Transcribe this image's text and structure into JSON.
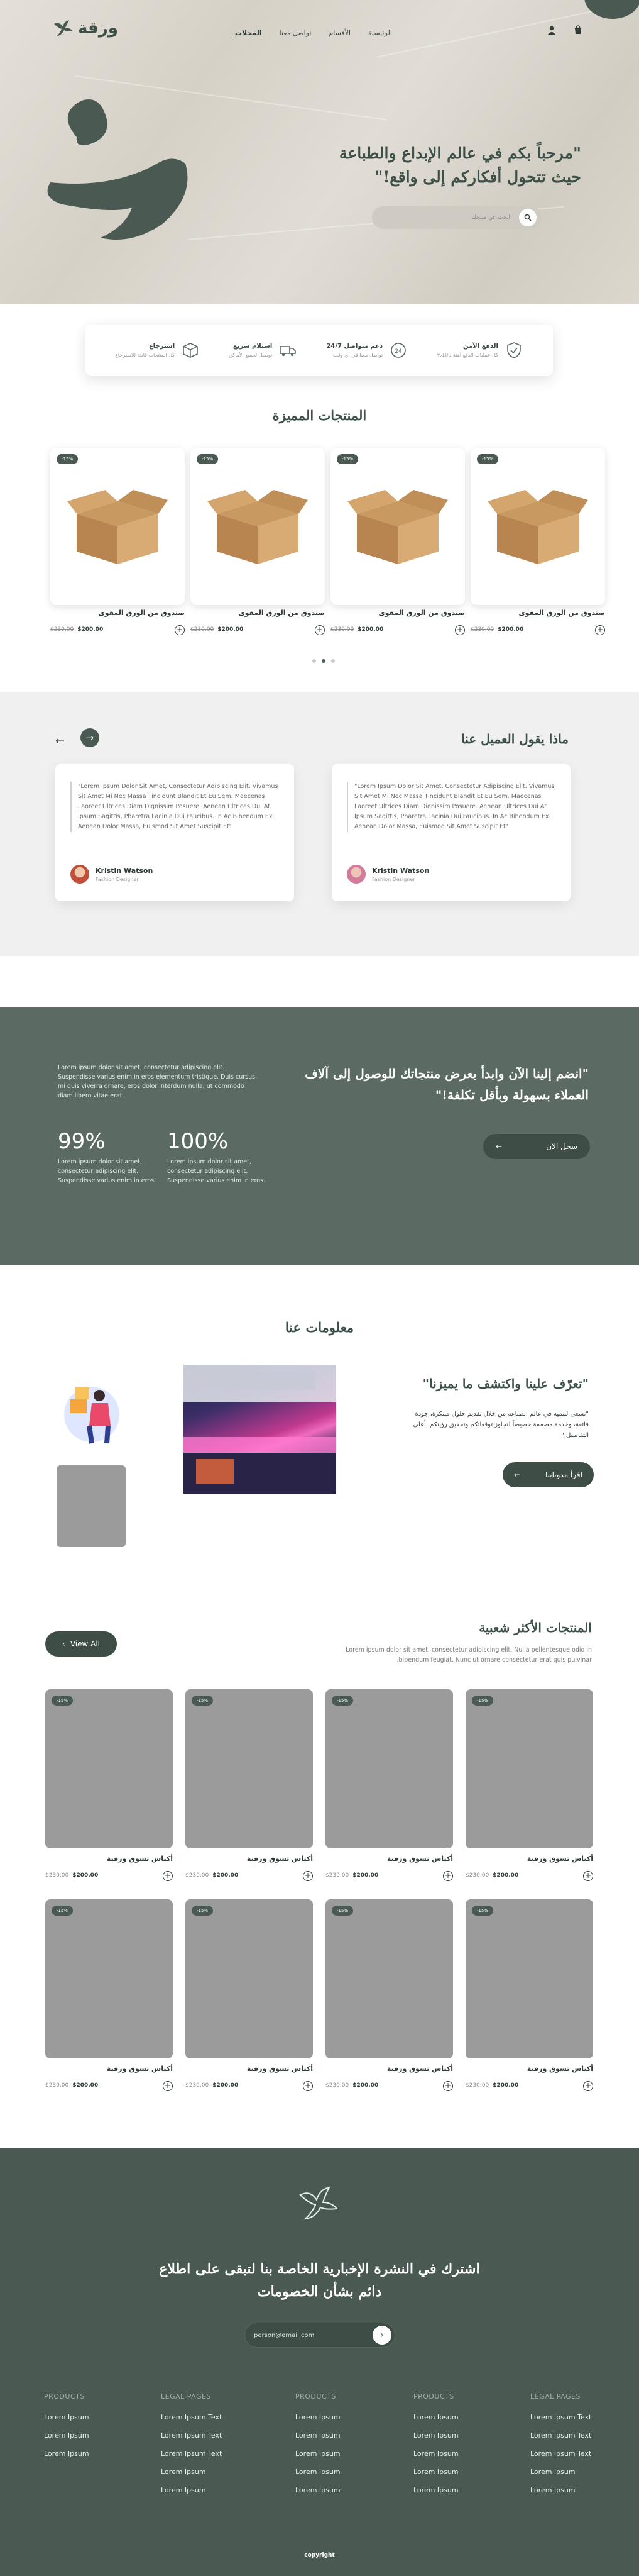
{
  "brand": {
    "name": "ورقة",
    "accent": "#4a5a53",
    "accent_dark": "#3f4d47"
  },
  "nav": {
    "items": [
      "الرئيسية",
      "الأقسام",
      "تواصل معنا",
      "المجلات"
    ],
    "active_index": 3
  },
  "hero": {
    "title_line1": "\"مرحباً بكم في عالم الإبداع والطباعة",
    "title_line2": "حيث تتحول أفكاركم إلى واقع!\"",
    "search_placeholder": "ابحث عن منتجك"
  },
  "features": [
    {
      "title": "الدفع الآمن",
      "subtitle": "كل عمليات الدفع آمنة 100%",
      "icon": "shield-check-icon"
    },
    {
      "title": "دعم متواصل 24/7",
      "subtitle": "تواصل معنا في أي وقت",
      "icon": "support-24-icon"
    },
    {
      "title": "استلام سريع",
      "subtitle": "توصيل لجميع الأماكن",
      "icon": "delivery-truck-icon"
    },
    {
      "title": "استرجاع",
      "subtitle": "كل المنتجات قابلة للاسترجاع",
      "icon": "package-return-icon"
    }
  ],
  "featured": {
    "title": "المنتجات المميزة",
    "products": [
      {
        "badge": "-15%",
        "name": "صندوق من الورق المقوى",
        "old_price": "$230.00",
        "price": "$200.00"
      },
      {
        "badge": "-15%",
        "name": "صندوق من الورق المقوى",
        "old_price": "$230.00",
        "price": "$200.00"
      },
      {
        "badge": "-15%",
        "name": "صندوق من الورق المقوى",
        "old_price": "$230.00",
        "price": "$200.00"
      },
      {
        "badge": "-15%",
        "name": "صندوق من الورق المقوى",
        "old_price": "$230.00",
        "price": "$200.00"
      }
    ],
    "carousel_active": 1
  },
  "testimonials": {
    "title": "ماذا يقول العميل عنا",
    "items": [
      {
        "quote": "\"Lorem Ipsum Dolor Sit Amet, Consectetur Adipiscing Elit. Vivamus Sit Amet Mi Nec Massa Tincidunt Blandit Et Eu Sem. Maecenas Laoreet Ultrices Diam Dignissim Posuere. Aenean Ultrices Dui At Ipsum Sagittis, Pharetra Lacinia Dui Faucibus. In Ac Bibendum Ex. Aenean Dolor Massa, Euismod Sit Amet Suscipit Et\"",
        "name": "Kristin Watson",
        "role": "Fashion Designer"
      },
      {
        "quote": "\"Lorem Ipsum Dolor Sit Amet, Consectetur Adipiscing Elit. Vivamus Sit Amet Mi Nec Massa Tincidunt Blandit Et Eu Sem. Maecenas Laoreet Ultrices Diam Dignissim Posuere. Aenean Ultrices Dui At Ipsum Sagittis, Pharetra Lacinia Dui Faucibus. In Ac Bibendum Ex. Aenean Dolor Massa, Euismod Sit Amet Suscipit Et\"",
        "name": "Kristin Watson",
        "role": "Fashion Designer"
      }
    ]
  },
  "join": {
    "title_line1": "\"انضم إلينا الآن وابدأ بعرض منتجاتك للوصول إلى آلاف",
    "title_line2": "العملاء بسهولة وبأقل تكلفة!\"",
    "button": "سجل الآن",
    "lead": "Lorem ipsum dolor sit amet, consectetur adipiscing elit. Suspendisse varius enim in eros elementum tristique. Duis cursus, mi quis viverra ornare, eros dolor interdum nulla, ut commodo diam libero vitae erat.",
    "stats": [
      {
        "value": "99%",
        "text": "Lorem ipsum dolor sit amet, consectetur adipiscing elit. Suspendisse varius enim in eros."
      },
      {
        "value": "100%",
        "text": "Lorem ipsum dolor sit amet, consectetur adipiscing elit. Suspendisse varius enim in eros."
      }
    ]
  },
  "about": {
    "title": "معلومات عنا",
    "subtitle": "\"تعرّف علينا واكتشف ما يميزنا\"",
    "text": "\"نسعى لتنمية في عالم الطباعة من خلال تقديم حلول مبتكرة، جودة فائقة، وخدمة مصممة خصيصاً لتجاوز توقعاتكم وتحقيق رؤيتكم بأعلى التفاصيل.\"",
    "button": "اقرأ مدوناتنا"
  },
  "popular": {
    "title": "المنتجات الأكثر شعبية",
    "description": "Lorem ipsum dolor sit amet, consectetur adipiscing elit. Nulla pellentesque odio in bibendum feugiat. Nunc ut ornare consectetur erat quis pulvinar.",
    "view_all": "View All",
    "products": [
      {
        "badge": "-15%",
        "name": "أكياس تسوق ورقية",
        "old_price": "$230.00",
        "price": "$200.00"
      },
      {
        "badge": "-15%",
        "name": "أكياس تسوق ورقية",
        "old_price": "$230.00",
        "price": "$200.00"
      },
      {
        "badge": "-15%",
        "name": "أكياس تسوق ورقية",
        "old_price": "$230.00",
        "price": "$200.00"
      },
      {
        "badge": "-15%",
        "name": "أكياس تسوق ورقية",
        "old_price": "$230.00",
        "price": "$200.00"
      },
      {
        "badge": "-15%",
        "name": "أكياس تسوق ورقية",
        "old_price": "$230.00",
        "price": "$200.00"
      },
      {
        "badge": "-15%",
        "name": "أكياس تسوق ورقية",
        "old_price": "$230.00",
        "price": "$200.00"
      },
      {
        "badge": "-15%",
        "name": "أكياس تسوق ورقية",
        "old_price": "$230.00",
        "price": "$200.00"
      },
      {
        "badge": "-15%",
        "name": "أكياس تسوق ورقية",
        "old_price": "$230.00",
        "price": "$200.00"
      }
    ]
  },
  "footer": {
    "newsletter_line1": "اشترك في النشرة الإخبارية الخاصة بنا لتبقى على اطلاع",
    "newsletter_line2": "دائم بشأن الخصومات",
    "email_placeholder": "person@email.com",
    "columns": [
      {
        "heading": "PRODUCTS",
        "links": [
          "Lorem Ipsum",
          "Lorem Ipsum",
          "Lorem Ipsum"
        ]
      },
      {
        "heading": "LEGAL PAGES",
        "links": [
          "Lorem Ipsum Text",
          "Lorem Ipsum Text",
          "Lorem Ipsum Text",
          "Lorem Ipsum",
          "Lorem Ipsum"
        ]
      },
      {
        "heading": "PRODUCTS",
        "links": [
          "Lorem Ipsum",
          "Lorem Ipsum",
          "Lorem Ipsum",
          "Lorem Ipsum",
          "Lorem Ipsum"
        ]
      },
      {
        "heading": "PRODUCTS",
        "links": [
          "Lorem Ipsum",
          "Lorem Ipsum",
          "Lorem Ipsum",
          "Lorem Ipsum",
          "Lorem Ipsum"
        ]
      },
      {
        "heading": "LEGAL PAGES",
        "links": [
          "Lorem Ipsum Text",
          "Lorem Ipsum Text",
          "Lorem Ipsum Text",
          "Lorem Ipsum",
          "Lorem Ipsum"
        ]
      }
    ],
    "copyright": "copyright"
  }
}
